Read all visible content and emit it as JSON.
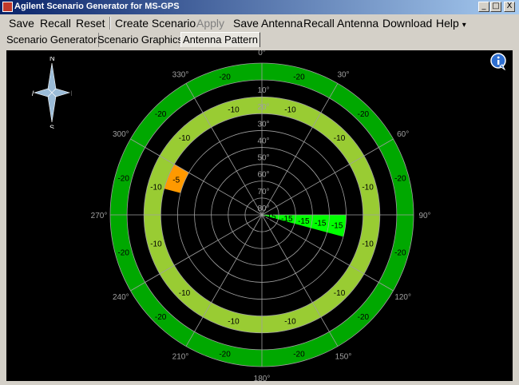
{
  "window": {
    "title": "Agilent Scenario Generator for MS-GPS",
    "minimize_glyph": "_",
    "maximize_glyph": "□",
    "close_glyph": "X"
  },
  "menu": {
    "items": [
      {
        "label": "Save",
        "enabled": true
      },
      {
        "label": "Recall",
        "enabled": true
      },
      {
        "label": "Reset",
        "enabled": true
      },
      {
        "label": "Create Scenario",
        "enabled": true
      },
      {
        "label": "Apply",
        "enabled": false
      },
      {
        "label": "Save Antenna",
        "enabled": true
      },
      {
        "label": "Recall Antenna",
        "enabled": true
      },
      {
        "label": "Download",
        "enabled": true
      },
      {
        "label": "Help",
        "enabled": true,
        "dropdown": "▾"
      }
    ]
  },
  "tabs": [
    {
      "label": "Scenario Generator",
      "active": false
    },
    {
      "label": "Scenario Graphics",
      "active": false
    },
    {
      "label": "Antenna Pattern",
      "active": true
    }
  ],
  "compass": {
    "n": "N",
    "s": "S",
    "e": "E",
    "w": "W"
  },
  "antenna_pattern": {
    "azimuth_labels": [
      "0°",
      "30°",
      "60°",
      "90°",
      "120°",
      "150°",
      "180°",
      "210°",
      "240°",
      "270°",
      "300°",
      "330°"
    ],
    "elevation_labels": [
      "0°",
      "10°",
      "20°",
      "30°",
      "40°",
      "50°",
      "60°",
      "70°",
      "80°"
    ],
    "cells": [
      {
        "el_min": 0,
        "el_max": 10,
        "az_min": 0,
        "az_max": 360,
        "value": "-20",
        "color": "#00a800"
      },
      {
        "el_min": 20,
        "el_max": 30,
        "az_min": 0,
        "az_max": 360,
        "value": "-10",
        "color": "#99cc33"
      },
      {
        "el_min": 30,
        "el_max": 40,
        "az_min": 285,
        "az_max": 300,
        "value": "-5",
        "color": "#ff9900"
      },
      {
        "el_min": 40,
        "el_max": 90,
        "az_min": 90,
        "az_max": 105,
        "value": "-15",
        "color": "#00ff00"
      }
    ],
    "colors": {
      "grid": "#a0a0a0",
      "label": "#a0a0a0",
      "background": "#000000"
    }
  }
}
